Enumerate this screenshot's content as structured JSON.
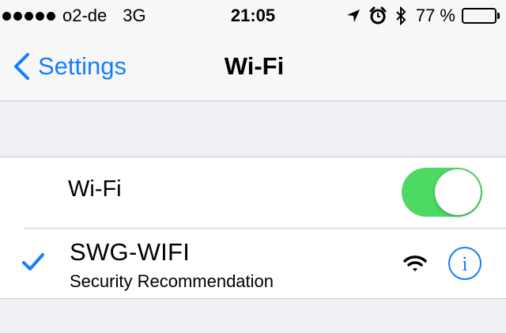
{
  "status_bar": {
    "carrier": "o2-de",
    "network_type": "3G",
    "time": "21:05",
    "battery_percent": "77 %",
    "battery_level": 0.77,
    "icons": [
      "location-arrow-icon",
      "alarm-clock-icon",
      "bluetooth-icon"
    ]
  },
  "nav": {
    "back_label": "Settings",
    "title": "Wi-Fi"
  },
  "wifi_toggle": {
    "label": "Wi-Fi",
    "on": true
  },
  "network": {
    "name": "SWG-WIFI",
    "subtitle": "Security Recommendation",
    "connected": true,
    "secured": false
  },
  "colors": {
    "accent": "#147efb",
    "toggle_on": "#4cd964",
    "background": "#efeff4"
  }
}
